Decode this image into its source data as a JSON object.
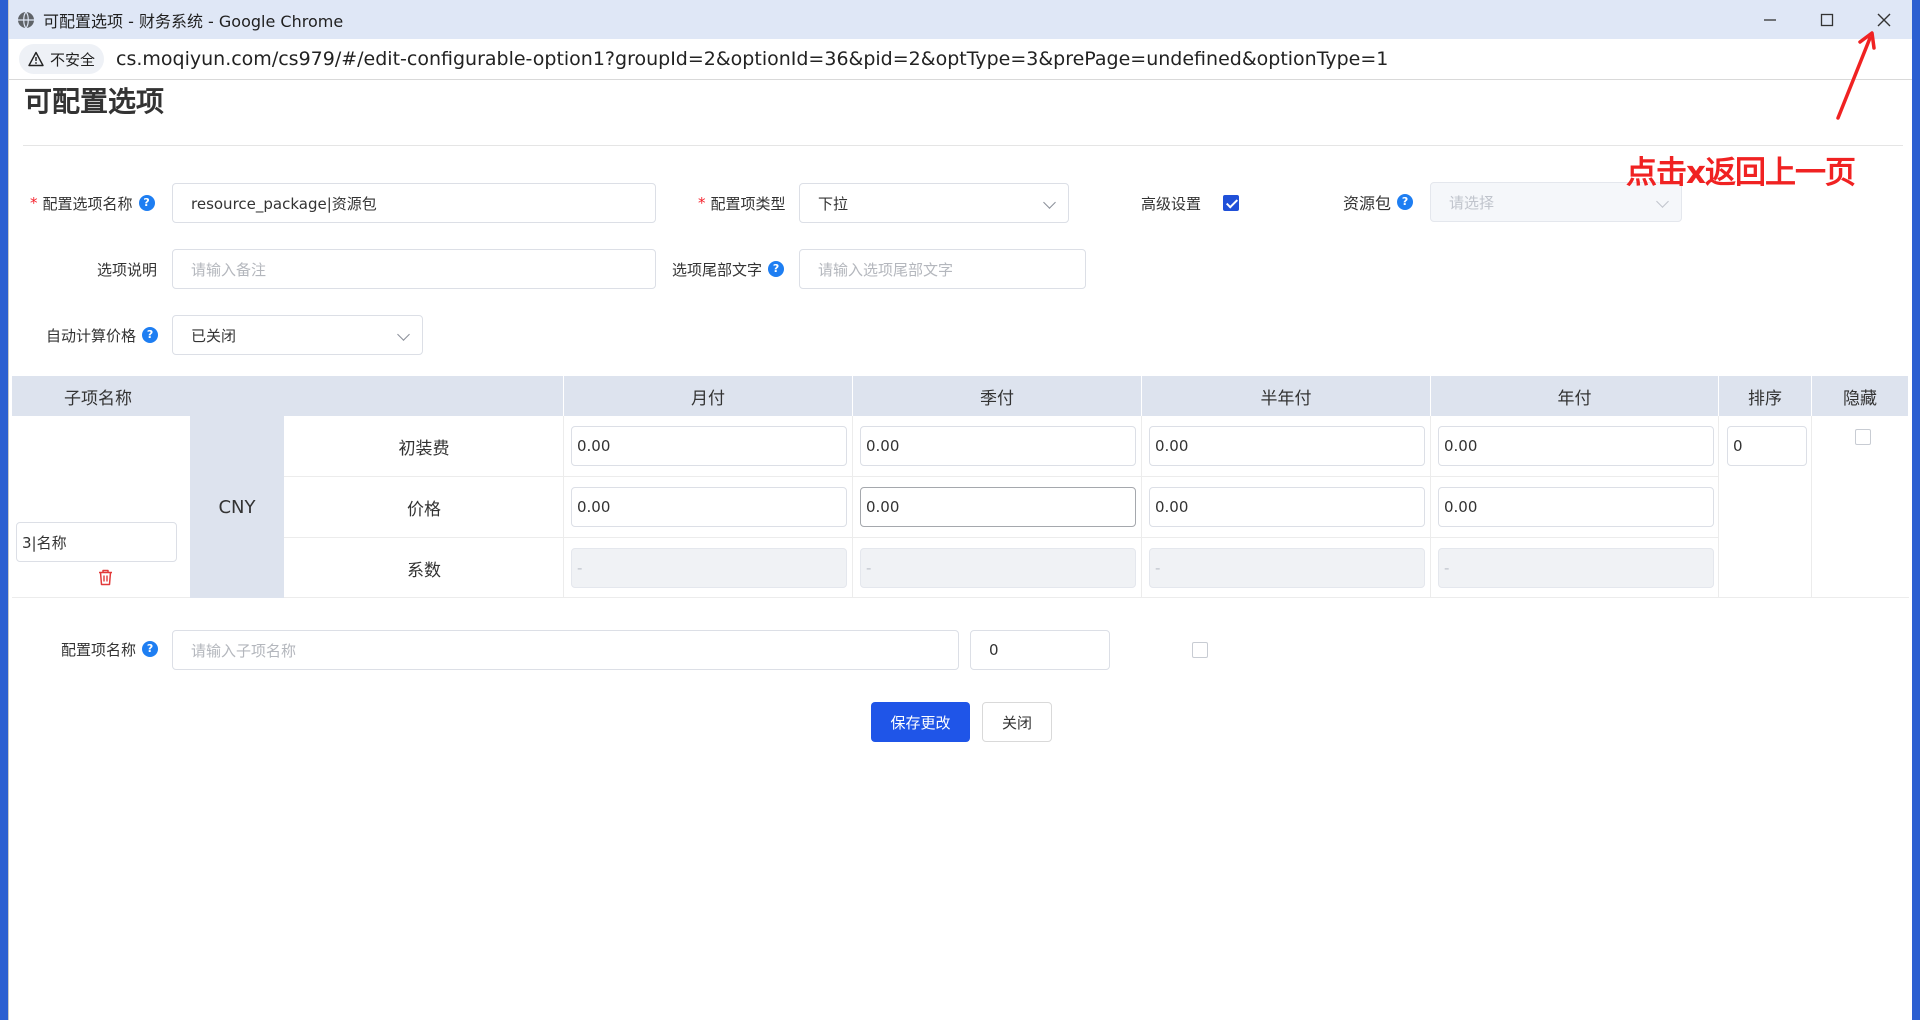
{
  "browser": {
    "window_title": "可配置选项 - 财务系统 - Google Chrome",
    "security_label": "不安全",
    "url": "cs.moqiyun.com/cs979/#/edit-configurable-option1?groupId=2&optionId=36&pid=2&optType=3&prePage=undefined&optionType=1"
  },
  "page": {
    "title": "可配置选项"
  },
  "form": {
    "option_name_label": "配置选项名称",
    "option_name_value": "resource_package|资源包",
    "option_type_label": "配置项类型",
    "option_type_value": "下拉",
    "advanced_label": "高级设置",
    "advanced_checked": true,
    "resource_pkg_label": "资源包",
    "resource_pkg_placeholder": "请选择",
    "desc_label": "选项说明",
    "desc_placeholder": "请输入备注",
    "suffix_label": "选项尾部文字",
    "suffix_placeholder": "请输入选项尾部文字",
    "auto_price_label": "自动计算价格",
    "auto_price_value": "已关闭"
  },
  "table": {
    "headers": {
      "sub_name": "子项名称",
      "monthly": "月付",
      "quarterly": "季付",
      "half_year": "半年付",
      "yearly": "年付",
      "sort": "排序",
      "hidden": "隐藏"
    },
    "currency": "CNY",
    "row_labels": {
      "setup": "初装费",
      "price": "价格",
      "factor": "系数"
    },
    "sub_item_name": "3|名称",
    "setup_values": [
      "0.00",
      "0.00",
      "0.00",
      "0.00"
    ],
    "price_values": [
      "0.00",
      "0.00",
      "0.00",
      "0.00"
    ],
    "factor_values": [
      "-",
      "-",
      "-",
      "-"
    ],
    "sort_value": "0"
  },
  "new_item": {
    "label": "配置项名称",
    "placeholder": "请输入子项名称",
    "sort_value": "0"
  },
  "buttons": {
    "save": "保存更改",
    "close": "关闭"
  },
  "annotation": {
    "text": "点击x返回上一页",
    "color": "#f02222"
  }
}
